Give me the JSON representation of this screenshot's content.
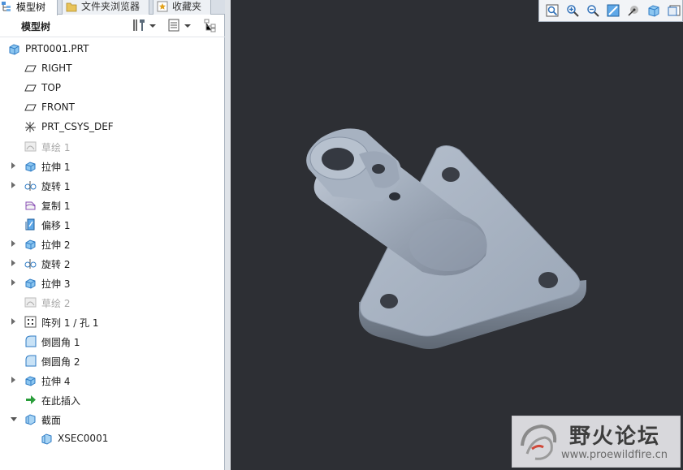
{
  "tabs": [
    {
      "label": "模型树",
      "icon": "model-tree-icon",
      "active": true
    },
    {
      "label": "文件夹浏览器",
      "icon": "folder-browser-icon",
      "active": false
    },
    {
      "label": "收藏夹",
      "icon": "favorites-icon",
      "active": false
    }
  ],
  "model_tree": {
    "title": "模型树",
    "tools": [
      "settings-icon",
      "show-icon",
      "filter-icon"
    ],
    "items": [
      {
        "label": "PRT0001.PRT",
        "icon": "part-icon",
        "kind": "root"
      },
      {
        "label": "RIGHT",
        "icon": "datum-plane-icon"
      },
      {
        "label": "TOP",
        "icon": "datum-plane-icon"
      },
      {
        "label": "FRONT",
        "icon": "datum-plane-icon"
      },
      {
        "label": "PRT_CSYS_DEF",
        "icon": "csys-icon"
      },
      {
        "label": "草绘 1",
        "icon": "sketch-icon",
        "suppressed": true
      },
      {
        "label": "拉伸 1",
        "icon": "extrude-icon",
        "expandable": true
      },
      {
        "label": "旋转 1",
        "icon": "revolve-icon",
        "expandable": true
      },
      {
        "label": "复制 1",
        "icon": "copy-icon"
      },
      {
        "label": "偏移 1",
        "icon": "offset-icon"
      },
      {
        "label": "拉伸 2",
        "icon": "extrude-icon",
        "expandable": true
      },
      {
        "label": "旋转 2",
        "icon": "revolve-icon",
        "expandable": true
      },
      {
        "label": "拉伸 3",
        "icon": "extrude-icon",
        "expandable": true
      },
      {
        "label": "草绘 2",
        "icon": "sketch-icon",
        "suppressed": true
      },
      {
        "label": "阵列 1 / 孔 1",
        "icon": "pattern-icon",
        "expandable": true
      },
      {
        "label": "倒圆角 1",
        "icon": "round-icon"
      },
      {
        "label": "倒圆角 2",
        "icon": "round-icon"
      },
      {
        "label": "拉伸 4",
        "icon": "extrude-icon",
        "expandable": true
      },
      {
        "label": "在此插入",
        "icon": "insert-here-icon"
      },
      {
        "label": "截面",
        "icon": "section-icon",
        "expanded": true
      },
      {
        "label": "XSEC0001",
        "icon": "section-icon",
        "kind": "child"
      }
    ]
  },
  "view_toolbar": [
    "refit-icon",
    "zoom-in-icon",
    "zoom-out-icon",
    "repaint-icon",
    "spin-center-icon",
    "display-style-icon",
    "saved-views-icon"
  ],
  "watermark": {
    "cn": "野火论坛",
    "url": "www.proewildfire.cn"
  },
  "colors": {
    "viewport_bg": "#2d2f34",
    "model": "#a5b0c0",
    "accent": "#2f7fd6"
  }
}
